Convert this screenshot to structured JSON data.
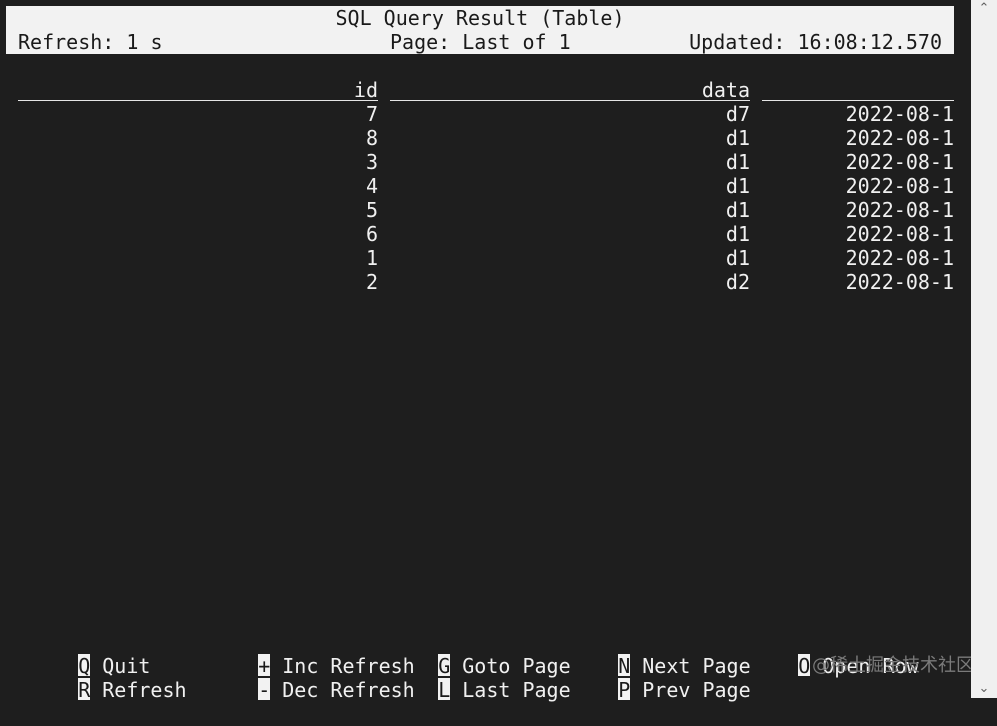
{
  "header": {
    "title": "SQL Query Result (Table)",
    "refresh": "Refresh: 1 s",
    "page": "Page: Last of 1",
    "updated": "Updated: 16:08:12.570"
  },
  "table": {
    "columns": [
      "id",
      "data",
      ""
    ],
    "rows": [
      {
        "id": "7",
        "data": "d7",
        "ts": "2022-08-1"
      },
      {
        "id": "8",
        "data": "d1",
        "ts": "2022-08-1"
      },
      {
        "id": "3",
        "data": "d1",
        "ts": "2022-08-1"
      },
      {
        "id": "4",
        "data": "d1",
        "ts": "2022-08-1"
      },
      {
        "id": "5",
        "data": "d1",
        "ts": "2022-08-1"
      },
      {
        "id": "6",
        "data": "d1",
        "ts": "2022-08-1"
      },
      {
        "id": "1",
        "data": "d1",
        "ts": "2022-08-1"
      },
      {
        "id": "2",
        "data": "d2",
        "ts": "2022-08-1"
      }
    ]
  },
  "footer": {
    "keys": [
      {
        "key": "Q",
        "label": "Quit"
      },
      {
        "key": "R",
        "label": "Refresh"
      },
      {
        "key": "+",
        "label": "Inc Refresh"
      },
      {
        "key": "-",
        "label": "Dec Refresh"
      },
      {
        "key": "G",
        "label": "Goto Page"
      },
      {
        "key": "L",
        "label": "Last Page"
      },
      {
        "key": "N",
        "label": "Next Page"
      },
      {
        "key": "P",
        "label": "Prev Page"
      },
      {
        "key": "O",
        "label": "Open Row"
      }
    ]
  },
  "watermark": "@稀土掘金技术社区",
  "scrollbar": {
    "up_icon": "chevron-up-icon",
    "down_icon": "chevron-down-icon"
  },
  "colors": {
    "background": "#1e1e1e",
    "foreground": "#f0f0f0",
    "bar": "#f2f2f2"
  }
}
